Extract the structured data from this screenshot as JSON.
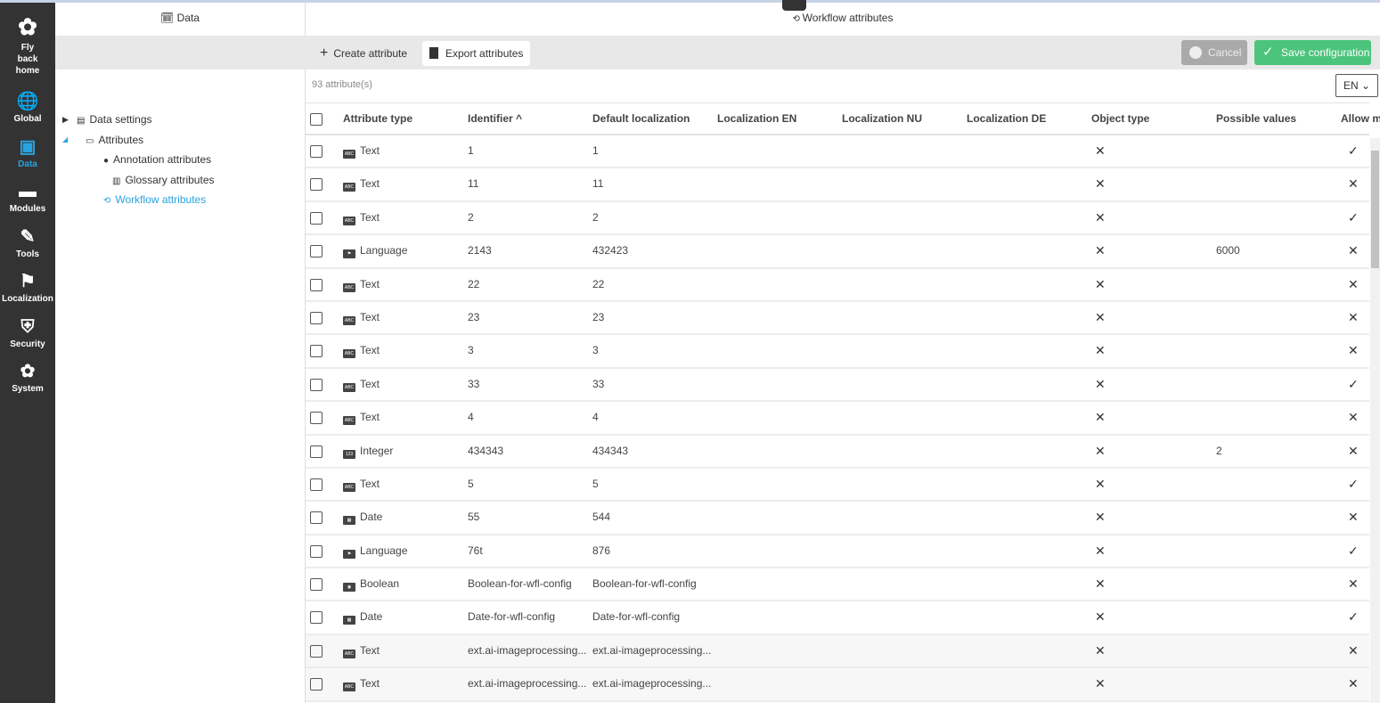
{
  "nav": {
    "home": "Fly back home",
    "items": [
      {
        "label": "Global",
        "icon": "globe-icon"
      },
      {
        "label": "Data",
        "icon": "calendar-edit-icon",
        "active": true
      },
      {
        "label": "Modules",
        "icon": "window-icon"
      },
      {
        "label": "Tools",
        "icon": "pencil-icon"
      },
      {
        "label": "Localization",
        "icon": "flag-icon"
      },
      {
        "label": "Security",
        "icon": "shield-check-icon"
      },
      {
        "label": "System",
        "icon": "gear-icon"
      }
    ]
  },
  "left": {
    "title": "Data",
    "tree": [
      {
        "label": "Data settings",
        "icon": "document-icon"
      },
      {
        "label": "Attributes",
        "icon": "attributes-icon"
      },
      {
        "label": "Annotation attributes",
        "icon": "pin-icon"
      },
      {
        "label": "Glossary attributes",
        "icon": "books-icon"
      },
      {
        "label": "Workflow attributes",
        "icon": "workflow-icon",
        "selected": true
      }
    ]
  },
  "main": {
    "title": "Workflow attributes",
    "create": "Create attribute",
    "export": "Export attributes",
    "cancel": "Cancel",
    "save": "Save configuration",
    "count": "93 attribute(s)",
    "lang": "EN",
    "columns": [
      "Attribute type",
      "Identifier ^",
      "Default localization",
      "Localization EN",
      "Localization NU",
      "Localization DE",
      "Object type",
      "Possible values",
      "Allow m"
    ],
    "rows": [
      {
        "type": "Text",
        "id": "1",
        "def": "1",
        "pv": "",
        "allow": "✓"
      },
      {
        "type": "Text",
        "id": "11",
        "def": "11",
        "pv": "",
        "allow": "✕"
      },
      {
        "type": "Text",
        "id": "2",
        "def": "2",
        "pv": "",
        "allow": "✓"
      },
      {
        "type": "Language",
        "id": "2143",
        "def": "432423",
        "pv": "6000",
        "allow": "✕"
      },
      {
        "type": "Text",
        "id": "22",
        "def": "22",
        "pv": "",
        "allow": "✕"
      },
      {
        "type": "Text",
        "id": "23",
        "def": "23",
        "pv": "",
        "allow": "✕"
      },
      {
        "type": "Text",
        "id": "3",
        "def": "3",
        "pv": "",
        "allow": "✕"
      },
      {
        "type": "Text",
        "id": "33",
        "def": "33",
        "pv": "",
        "allow": "✓"
      },
      {
        "type": "Text",
        "id": "4",
        "def": "4",
        "pv": "",
        "allow": "✕"
      },
      {
        "type": "Integer",
        "id": "434343",
        "def": "434343",
        "pv": "2",
        "allow": "✕"
      },
      {
        "type": "Text",
        "id": "5",
        "def": "5",
        "pv": "",
        "allow": "✓"
      },
      {
        "type": "Date",
        "id": "55",
        "def": "544",
        "pv": "",
        "allow": "✕"
      },
      {
        "type": "Language",
        "id": "76t",
        "def": "876",
        "pv": "",
        "allow": "✓"
      },
      {
        "type": "Boolean",
        "id": "Boolean-for-wfl-config",
        "def": "Boolean-for-wfl-config",
        "pv": "",
        "allow": "✕"
      },
      {
        "type": "Date",
        "id": "Date-for-wfl-config",
        "def": "Date-for-wfl-config",
        "pv": "",
        "allow": "✓"
      },
      {
        "type": "Text",
        "id": "ext.ai-imageprocessing...",
        "def": "ext.ai-imageprocessing...",
        "pv": "",
        "allow": "✕"
      },
      {
        "type": "Text",
        "id": "ext.ai-imageprocessing...",
        "def": "ext.ai-imageprocessing...",
        "pv": "",
        "allow": "✕"
      }
    ],
    "object_type_mark": "✕"
  }
}
